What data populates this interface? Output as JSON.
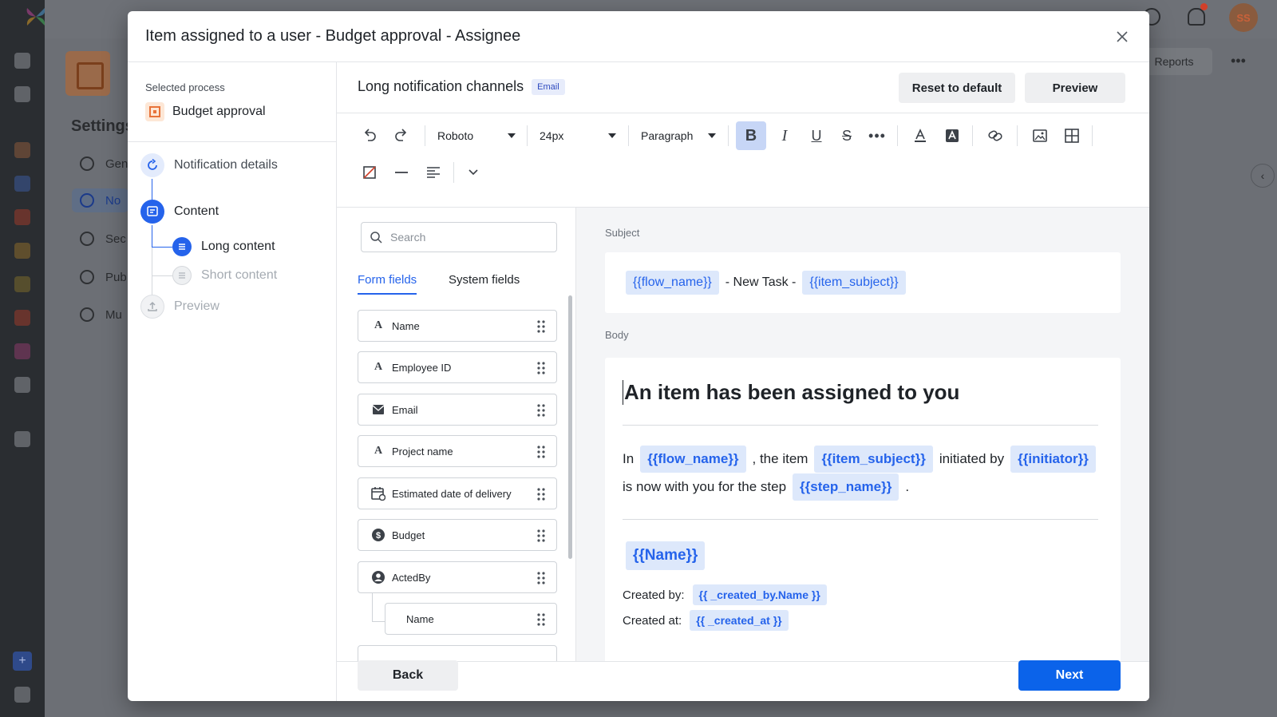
{
  "background": {
    "settings_title": "Settings",
    "menu": [
      "Gen",
      "No",
      "Sec",
      "Pub",
      "Mu"
    ],
    "reports_label": "Reports",
    "more_label": "•••",
    "avatar_initials": "SS"
  },
  "modal": {
    "title": "Item assigned to a user - Budget approval - Assignee",
    "close_icon": "close-icon"
  },
  "steps": {
    "selected_label": "Selected process",
    "process_name": "Budget approval",
    "items": {
      "notification_details": "Notification details",
      "content": "Content",
      "long_content": "Long content",
      "short_content": "Short content",
      "preview": "Preview"
    }
  },
  "header": {
    "channel_title": "Long notification channels",
    "badge": "Email",
    "reset_label": "Reset to default",
    "preview_label": "Preview"
  },
  "toolbar": {
    "font": "Roboto",
    "size": "24px",
    "block": "Paragraph",
    "bold_active": true
  },
  "fields_panel": {
    "search_placeholder": "Search",
    "tabs": [
      "Form fields",
      "System fields"
    ],
    "active_tab": "Form fields",
    "fields": [
      {
        "label": "Name",
        "icon": "text-icon"
      },
      {
        "label": "Employee ID",
        "icon": "text-icon"
      },
      {
        "label": "Email",
        "icon": "mail-icon"
      },
      {
        "label": "Project name",
        "icon": "text-icon"
      },
      {
        "label": "Estimated date of delivery",
        "icon": "calendar-icon"
      },
      {
        "label": "Budget",
        "icon": "dollar-icon"
      },
      {
        "label": "ActedBy",
        "icon": "user-icon"
      },
      {
        "label": "Name",
        "icon": "",
        "nested": true
      }
    ]
  },
  "preview": {
    "subject_label": "Subject",
    "subject": {
      "token1": "{{flow_name}}",
      "text": "- New Task -",
      "token2": "{{item_subject}}"
    },
    "body_label": "Body",
    "heading": "An item has been assigned to you",
    "line1": {
      "t1": "In",
      "tok1": "{{flow_name}}",
      "t2": ", the item",
      "tok2": "{{item_subject}}",
      "t3": "initiated by",
      "tok3": "{{initiator}}"
    },
    "line2": {
      "t1": "is now with you for the step",
      "tok1": "{{step_name}}",
      "t2": "."
    },
    "name_token": "{{Name}}",
    "created_by_label": "Created by:",
    "created_by_token": "{{ _created_by.Name }}",
    "created_at_label": "Created at:",
    "created_at_token": "{{ _created_at }}"
  },
  "footer": {
    "back_label": "Back",
    "next_label": "Next"
  },
  "colors": {
    "accent": "#2563eb",
    "primary_button": "#0b63ea",
    "token_bg": "#dde8fb",
    "process_icon": "#e8733a"
  }
}
